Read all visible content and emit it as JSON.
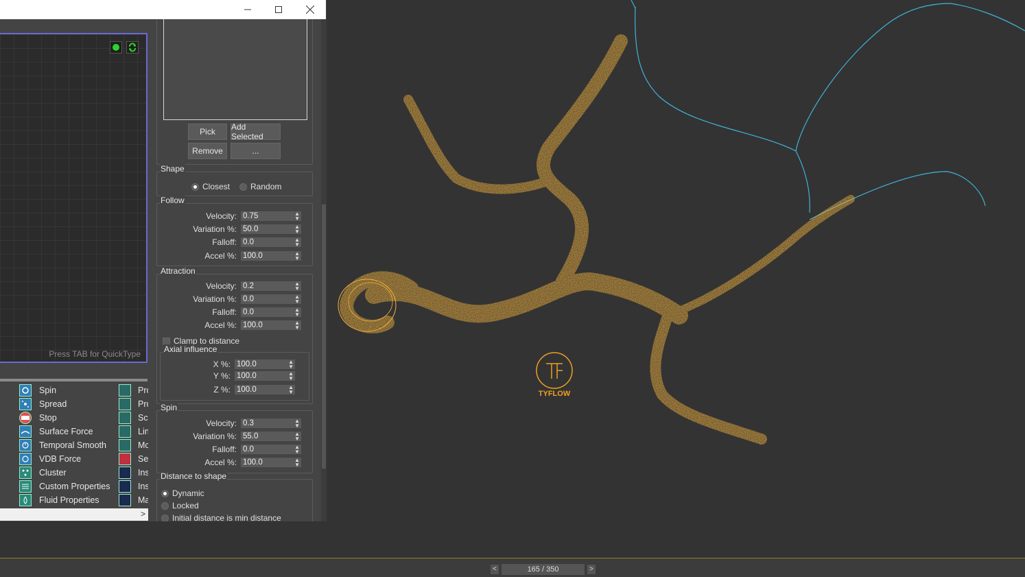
{
  "window": {
    "controls": {
      "minimize_icon": "minimize-icon",
      "maximize_icon": "maximize-icon",
      "close_icon": "close-icon"
    }
  },
  "graph": {
    "hint": "Press TAB for QuickType"
  },
  "operators": {
    "left_column": [
      {
        "label": "Spin",
        "icon": "spin-icon"
      },
      {
        "label": "Spread",
        "icon": "spread-icon"
      },
      {
        "label": "Stop",
        "icon": "stop-icon"
      },
      {
        "label": "Surface Force",
        "icon": "surface-force-icon"
      },
      {
        "label": "Temporal Smooth",
        "icon": "temporal-smooth-icon"
      },
      {
        "label": "VDB Force",
        "icon": "vdb-force-icon"
      },
      {
        "label": "Cluster",
        "icon": "cluster-icon"
      },
      {
        "label": "Custom Properties",
        "icon": "custom-properties-icon"
      },
      {
        "label": "Fluid Properties",
        "icon": "fluid-properties-icon"
      }
    ],
    "right_column": [
      "Pro",
      "Pro",
      "Scr",
      "Lin",
      "Mc",
      "Set",
      "Ins",
      "Ins",
      "Ma"
    ],
    "scroll_right": ">"
  },
  "shape_objects": {
    "pick_label": "Pick",
    "add_selected_label": "Add Selected",
    "remove_label": "Remove",
    "more_label": "..."
  },
  "shape": {
    "title": "Shape",
    "closest": "Closest",
    "random": "Random"
  },
  "follow": {
    "title": "Follow",
    "rows": [
      {
        "label": "Velocity:",
        "value": "0.75"
      },
      {
        "label": "Variation %:",
        "value": "50.0"
      },
      {
        "label": "Falloff:",
        "value": "0.0"
      },
      {
        "label": "Accel %:",
        "value": "100.0"
      }
    ]
  },
  "attraction": {
    "title": "Attraction",
    "rows": [
      {
        "label": "Velocity:",
        "value": "0.2"
      },
      {
        "label": "Variation %:",
        "value": "0.0"
      },
      {
        "label": "Falloff:",
        "value": "0.0"
      },
      {
        "label": "Accel %:",
        "value": "100.0"
      }
    ],
    "clamp": "Clamp to distance",
    "axial_title": "Axial influence",
    "axial": [
      {
        "label": "X %:",
        "value": "100.0"
      },
      {
        "label": "Y %:",
        "value": "100.0"
      },
      {
        "label": "Z %:",
        "value": "100.0"
      }
    ]
  },
  "spin": {
    "title": "Spin",
    "rows": [
      {
        "label": "Velocity:",
        "value": "0.3"
      },
      {
        "label": "Variation %:",
        "value": "55.0"
      },
      {
        "label": "Falloff:",
        "value": "0.0"
      },
      {
        "label": "Accel %:",
        "value": "100.0"
      }
    ]
  },
  "distance": {
    "title": "Distance to shape",
    "dynamic": "Dynamic",
    "locked": "Locked",
    "initial": "Initial distance is min distance"
  },
  "viewport": {
    "logo_text": "TYFLOW"
  },
  "timeline": {
    "prev": "<",
    "next": ">",
    "frame": "165 / 350",
    "current_frame": 165,
    "total_frames": 350
  },
  "colors": {
    "particles": "#f5b43c",
    "spline": "#3fb4d8",
    "viewport_bg": "#333333",
    "graph_border": "#6a6ad8"
  }
}
